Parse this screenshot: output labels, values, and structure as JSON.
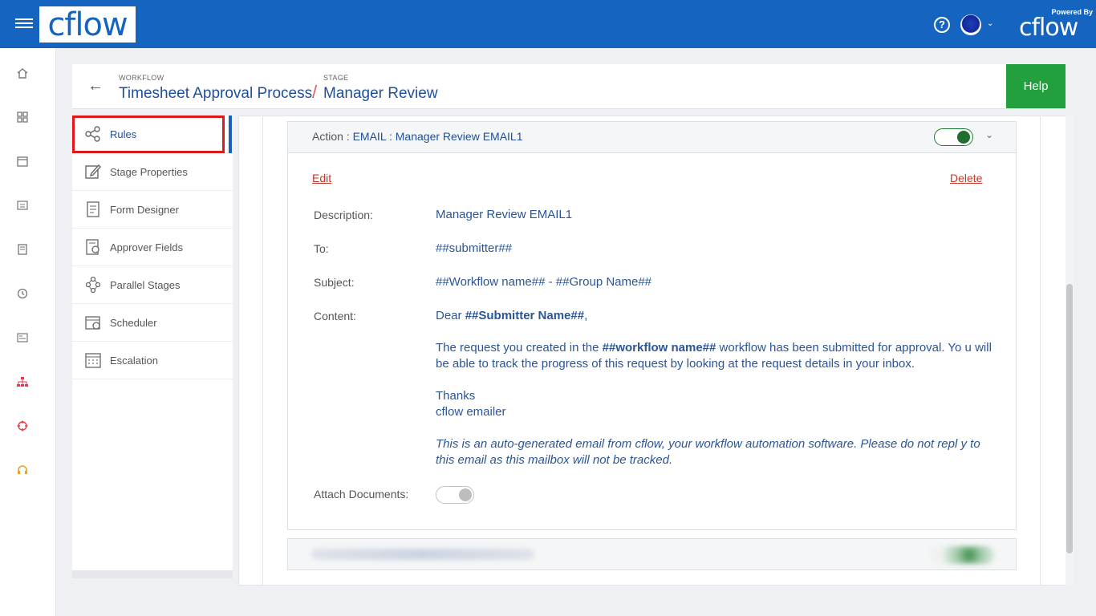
{
  "topbar": {
    "logo_text": "cflow",
    "help_symbol": "?",
    "powered_by": "Powered By",
    "powered_logo": "cflow"
  },
  "rail": {
    "icons": [
      "home-icon",
      "apps-grid-icon",
      "calendar-icon",
      "id-card-icon",
      "book-icon",
      "history-icon",
      "report-icon",
      "hierarchy-icon",
      "target-icon",
      "headset-icon"
    ],
    "accent_colors": {
      "hierarchy": "#e53950",
      "target": "#e53950",
      "headset": "#f0a020"
    }
  },
  "header": {
    "workflow_caption": "WORKFLOW",
    "workflow_name": "Timesheet Approval Process",
    "separator": "/",
    "stage_caption": "STAGE",
    "stage_name": "Manager Review",
    "help_label": "Help"
  },
  "sidemenu": {
    "items": [
      {
        "label": "Rules",
        "icon": "share-icon"
      },
      {
        "label": "Stage Properties",
        "icon": "edit-icon"
      },
      {
        "label": "Form Designer",
        "icon": "form-icon"
      },
      {
        "label": "Approver Fields",
        "icon": "approver-icon"
      },
      {
        "label": "Parallel Stages",
        "icon": "parallel-icon"
      },
      {
        "label": "Scheduler",
        "icon": "scheduler-icon"
      },
      {
        "label": "Escalation",
        "icon": "escalation-icon"
      }
    ]
  },
  "action": {
    "prefix": "Action : ",
    "type": "EMAIL : Manager Review EMAIL1",
    "enabled": true,
    "edit_label": "Edit",
    "delete_label": "Delete",
    "fields": {
      "description_label": "Description:",
      "description_value": "Manager Review EMAIL1",
      "to_label": "To:",
      "to_value": "##submitter##",
      "subject_label": "Subject:",
      "subject_value": "##Workflow name## - ##Group Name##",
      "content_label": "Content:",
      "attach_label": "Attach Documents:"
    },
    "content": {
      "greeting_prefix": "Dear ",
      "greeting_name": "##Submitter Name##",
      "greeting_suffix": ",",
      "para1_prefix": "The request you created in the ",
      "para1_bold": "##workflow name##",
      "para1_suffix": " workflow has been submitted for approval. Yo u will be able to track the progress of this request by looking at the request details in your inbox.",
      "thanks": "Thanks",
      "signature": "cflow emailer",
      "footer": "This is an auto-generated email from cflow, your workflow automation software. Please do not repl y to this email as this mailbox will not be tracked."
    },
    "attach_enabled": false
  },
  "colors": {
    "topbar": "#1565c0",
    "help_button": "#23a03e",
    "link_red": "#c0392b",
    "value_blue": "#2a5597",
    "highlight_red": "#e01818"
  }
}
